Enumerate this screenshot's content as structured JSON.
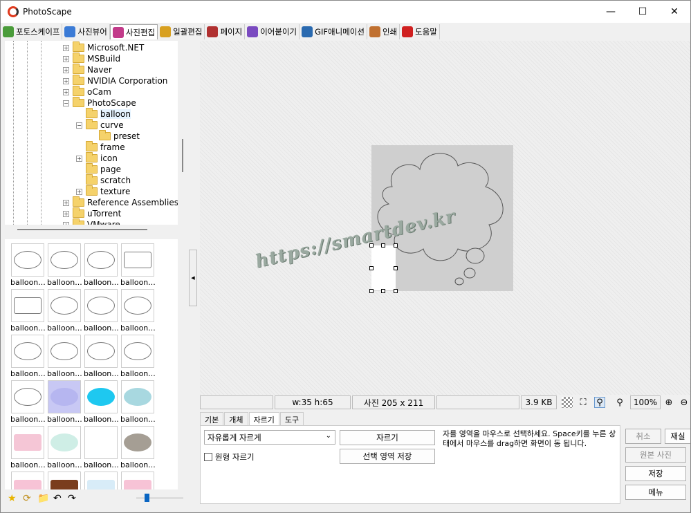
{
  "window": {
    "title": "PhotoScape"
  },
  "tabs": [
    {
      "label": "포토스케이프",
      "color": "#4a9c3a"
    },
    {
      "label": "사진뷰어",
      "color": "#3b7bd6"
    },
    {
      "label": "사진편집",
      "color": "#c23b8a"
    },
    {
      "label": "일괄편집",
      "color": "#d8a020"
    },
    {
      "label": "페이지",
      "color": "#b03030"
    },
    {
      "label": "이어붙이기",
      "color": "#7a4ac0"
    },
    {
      "label": "GIF애니메이션",
      "color": "#2a6ab0"
    },
    {
      "label": "인쇄",
      "color": "#c07030"
    },
    {
      "label": "도움말",
      "color": "#d02020"
    }
  ],
  "tree": [
    {
      "label": "Microsoft.NET",
      "expander": "+"
    },
    {
      "label": "MSBuild",
      "expander": "+"
    },
    {
      "label": "Naver",
      "expander": "+"
    },
    {
      "label": "NVIDIA Corporation",
      "expander": "+"
    },
    {
      "label": "oCam",
      "expander": "+"
    },
    {
      "label": "PhotoScape",
      "expander": "−"
    },
    {
      "label": "balloon",
      "expander": ""
    },
    {
      "label": "curve",
      "expander": "−"
    },
    {
      "label": "preset",
      "expander": ""
    },
    {
      "label": "frame",
      "expander": ""
    },
    {
      "label": "icon",
      "expander": "+"
    },
    {
      "label": "page",
      "expander": ""
    },
    {
      "label": "scratch",
      "expander": ""
    },
    {
      "label": "texture",
      "expander": "+"
    },
    {
      "label": "Reference Assemblies",
      "expander": "+"
    },
    {
      "label": "uTorrent",
      "expander": "+"
    },
    {
      "label": "VMware",
      "expander": "+"
    }
  ],
  "thumbs": {
    "label": "balloon..."
  },
  "canvas": {
    "watermark": "https://smartdev.kr"
  },
  "status": {
    "selection": "w:35 h:65",
    "photo_size": "사진 205 x 211",
    "file_size": "3.9 KB",
    "zoom": "100%"
  },
  "panel": {
    "tabs": [
      "기본",
      "개체",
      "자르기",
      "도구"
    ],
    "crop_mode": "자유롭게 자르게",
    "crop_button": "자르기",
    "save_selection_button": "선택 영역 저장",
    "circle_crop": "원형 자르기",
    "hint": "자를 영역을 마우스로 선택하세요. Space키를 누른 상태에서 마우스를 drag하면 화면이 동 됩니다."
  },
  "actions": {
    "cancel": "취소",
    "redo": "재실",
    "original": "원본 사진",
    "save": "저장",
    "menu": "메뉴"
  }
}
